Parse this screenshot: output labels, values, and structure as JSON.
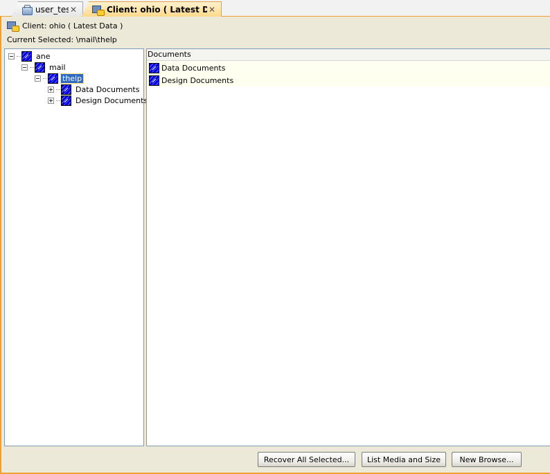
{
  "tabs": [
    {
      "label": "user_test",
      "icon": "server-icon",
      "close": "✕"
    },
    {
      "label": "Client: ohio ( Latest Dat...",
      "icon": "client-icon",
      "close": "✕"
    }
  ],
  "header": {
    "client_label": "Client: ohio ( Latest Data )",
    "current_selected": "Current Selected: \\mail\\thelp"
  },
  "tree": {
    "nodes": [
      {
        "label": "ane",
        "expander": "minus"
      },
      {
        "label": "mail",
        "expander": "minus"
      },
      {
        "label": "thelp",
        "expander": "minus",
        "selected": true
      },
      {
        "label": "Data Documents",
        "expander": "plus"
      },
      {
        "label": "Design Documents",
        "expander": "plus"
      }
    ]
  },
  "content": {
    "header": "Documents",
    "items": [
      {
        "label": "Data Documents"
      },
      {
        "label": "Design Documents"
      }
    ]
  },
  "buttons": {
    "recover": "Recover All Selected...",
    "list_media": "List Media and Size",
    "new_browse": "New Browse..."
  },
  "colors": {
    "accent": "#f0a030",
    "selection": "#316ac5",
    "folder": "#0000dd"
  }
}
